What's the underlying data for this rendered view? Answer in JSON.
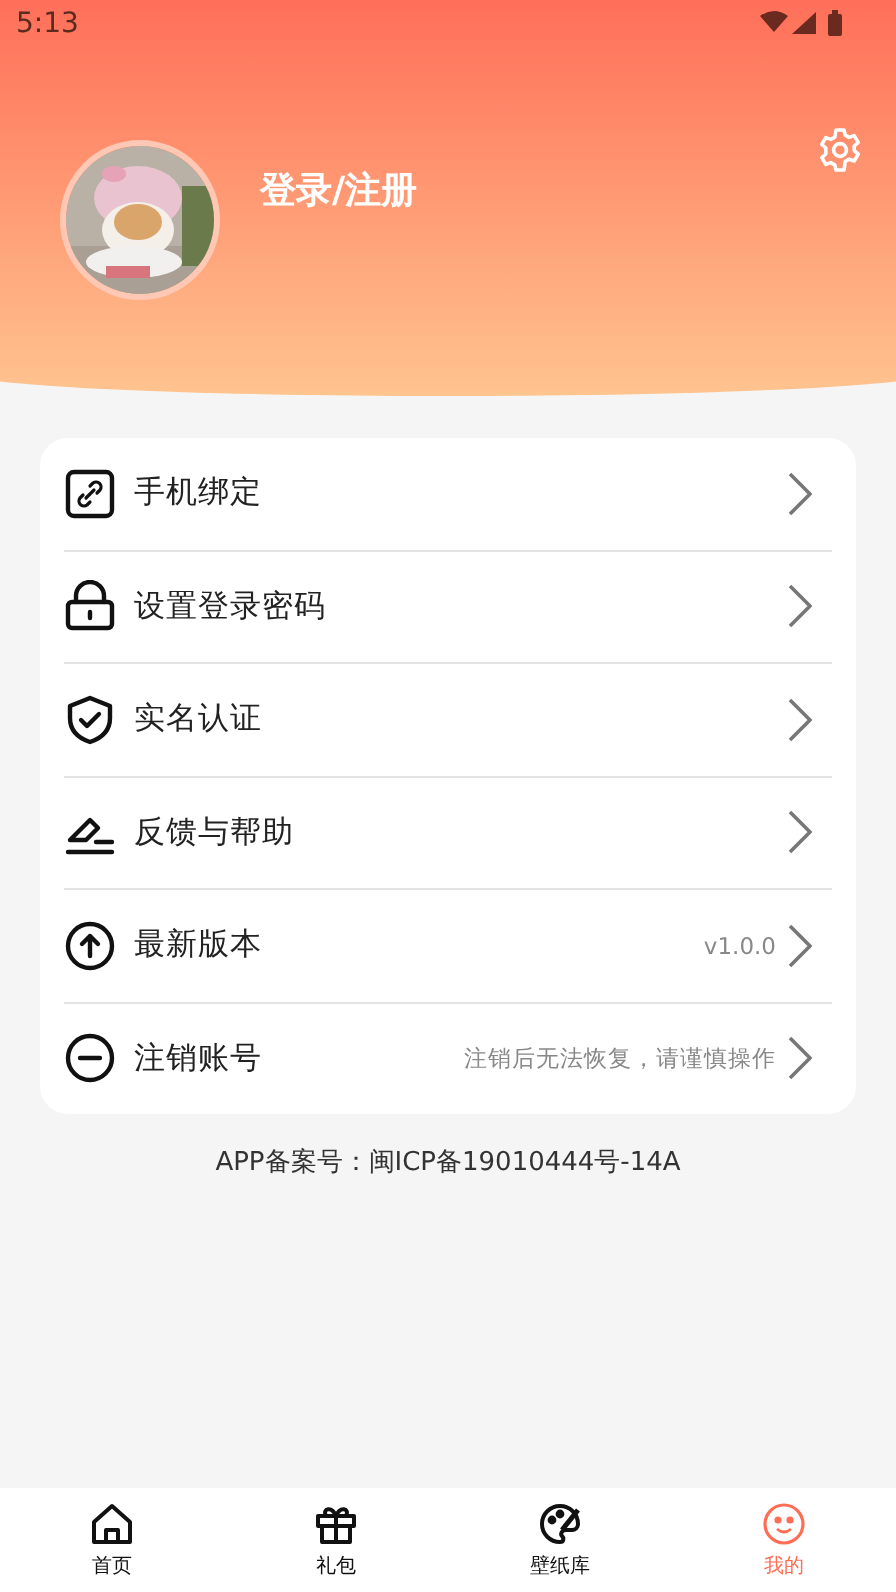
{
  "status_bar": {
    "time": "5:13"
  },
  "header": {
    "title": "登录/注册"
  },
  "menu": [
    {
      "label": "手机绑定"
    },
    {
      "label": "设置登录密码"
    },
    {
      "label": "实名认证"
    },
    {
      "label": "反馈与帮助"
    },
    {
      "label": "最新版本",
      "note": "v1.0.0"
    },
    {
      "label": "注销账号",
      "note": "注销后无法恢复，请谨慎操作"
    }
  ],
  "footer": "APP备案号：闽ICP备19010444号-14A",
  "tabs": [
    {
      "label": "首页",
      "selected": false
    },
    {
      "label": "礼包",
      "selected": false
    },
    {
      "label": "壁纸库",
      "selected": false
    },
    {
      "label": "我的",
      "selected": true
    }
  ]
}
